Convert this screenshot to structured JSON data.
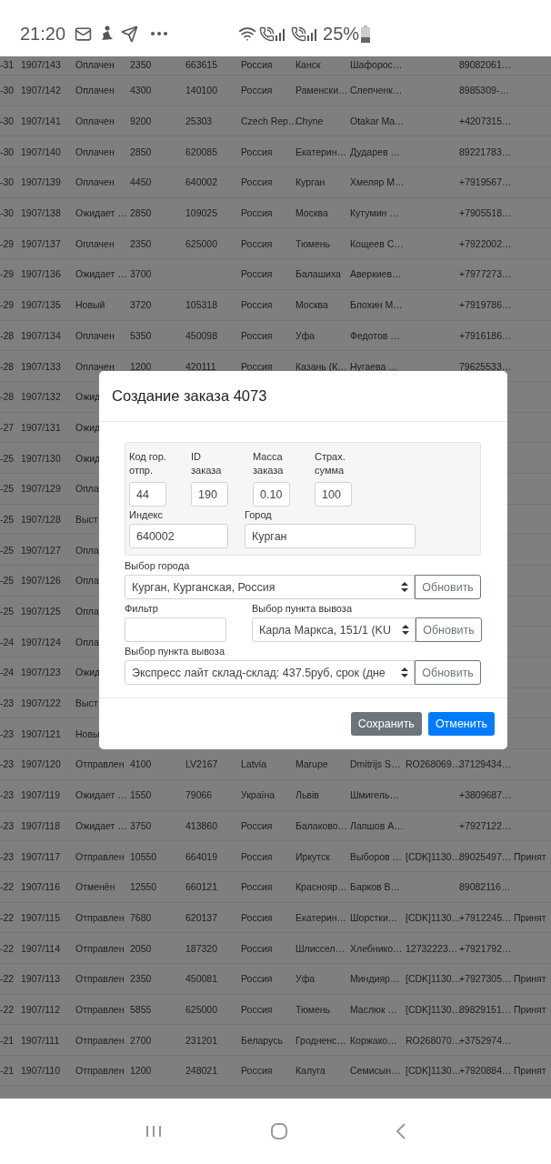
{
  "status_bar": {
    "time": "21:20",
    "battery": "25%"
  },
  "table": {
    "rows": [
      {
        "date": "-31",
        "id": "1907/143",
        "status": "Оплачен",
        "sum": "2350",
        "index": "663615",
        "country": "Россия",
        "city": "Канск",
        "name": "Шафорос…",
        "phone": "89082061…"
      },
      {
        "date": "-30",
        "id": "1907/142",
        "status": "Оплачен",
        "sum": "4300",
        "index": "140100",
        "country": "Россия",
        "city": "Раменски…",
        "name": "Слепченк…",
        "phone": "8985309-…"
      },
      {
        "date": "-30",
        "id": "1907/141",
        "status": "Оплачен",
        "sum": "9200",
        "index": "25303",
        "country": "Czech Rep…",
        "city": "Chyne",
        "name": "Otakar Ma…",
        "phone": "+4207315…"
      },
      {
        "date": "-30",
        "id": "1907/140",
        "status": "Оплачен",
        "sum": "2850",
        "index": "620085",
        "country": "Россия",
        "city": "Екатерин…",
        "name": "Дударев …",
        "phone": "89221783…"
      },
      {
        "date": "-30",
        "id": "1907/139",
        "status": "Оплачен",
        "sum": "4450",
        "index": "640002",
        "country": "Россия",
        "city": "Курган",
        "name": "Хмеляр М…",
        "phone": "+7919567…"
      },
      {
        "date": "-30",
        "id": "1907/138",
        "status": "Ожидает …",
        "sum": "2850",
        "index": "109025",
        "country": "Россия",
        "city": "Москва",
        "name": "Кутумин …",
        "phone": "+7905518…"
      },
      {
        "date": "-29",
        "id": "1907/137",
        "status": "Оплачен",
        "sum": "2350",
        "index": "625000",
        "country": "Россия",
        "city": "Тюмень",
        "name": "Кощеев С…",
        "phone": "+7922002…"
      },
      {
        "date": "-29",
        "id": "1907/136",
        "status": "Ожидает …",
        "sum": "3700",
        "country": "Россия",
        "city": "Балашиха",
        "name": "Аверкиев…",
        "phone": "+7977273…"
      },
      {
        "date": "-29",
        "id": "1907/135",
        "status": "Новый",
        "sum": "3720",
        "index": "105318",
        "country": "Россия",
        "city": "Москва",
        "name": "Блохин М…",
        "phone": "+7919786…"
      },
      {
        "date": "-28",
        "id": "1907/134",
        "status": "Оплачен",
        "sum": "5350",
        "index": "450098",
        "country": "Россия",
        "city": "Уфа",
        "name": "Федотов …",
        "phone": "+7916186…"
      },
      {
        "date": "-28",
        "id": "1907/133",
        "status": "Оплачен",
        "sum": "1200",
        "index": "420111",
        "country": "Россия",
        "city": "Казань (К…",
        "name": "Нугаева …",
        "phone": "79625533…"
      },
      {
        "date": "-28",
        "id": "1907/132",
        "status": "Ожид"
      },
      {
        "date": "-27",
        "id": "1907/131",
        "status": "Ожид"
      },
      {
        "date": "-25",
        "id": "1907/130",
        "status": "Ожид"
      },
      {
        "date": "-25",
        "id": "1907/129",
        "status": "Опла"
      },
      {
        "date": "-25",
        "id": "1907/128",
        "status": "Выст"
      },
      {
        "date": "-25",
        "id": "1907/127",
        "status": "Опла"
      },
      {
        "date": "-25",
        "id": "1907/126",
        "status": "Опла"
      },
      {
        "date": "-25",
        "id": "1907/125",
        "status": "Опла"
      },
      {
        "date": "-24",
        "id": "1907/124",
        "status": "Опла"
      },
      {
        "date": "-24",
        "id": "1907/123",
        "status": "Ожид"
      },
      {
        "date": "-23",
        "id": "1907/122",
        "status": "Выст"
      },
      {
        "date": "-23",
        "id": "1907/121",
        "status": "Новы"
      },
      {
        "date": "-23",
        "id": "1907/120",
        "status": "Отправлен",
        "sum": "4100",
        "index": "LV2167",
        "country": "Latvia",
        "city": "Marupe",
        "name": "Dmitrijs S…",
        "track": "RO268069…",
        "phone": "37129434…"
      },
      {
        "date": "-23",
        "id": "1907/119",
        "status": "Ожидает …",
        "sum": "1550",
        "index": "79066",
        "country": "Україна",
        "city": "Львів",
        "name": "Шмигель…",
        "phone": "+3809687…"
      },
      {
        "date": "-23",
        "id": "1907/118",
        "status": "Ожидает …",
        "sum": "3750",
        "index": "413860",
        "country": "Россия",
        "city": "Балаково…",
        "name": "Лапшов А…",
        "phone": "+7927122…"
      },
      {
        "date": "-23",
        "id": "1907/117",
        "status": "Отправлен",
        "sum": "10550",
        "index": "664019",
        "country": "Россия",
        "city": "Иркутск",
        "name": "Выборов …",
        "track": "[CDK]1130…",
        "phone": "89025497…",
        "comment": "Принят"
      },
      {
        "date": "-22",
        "id": "1907/116",
        "status": "Отменён",
        "sum": "12550",
        "index": "660121",
        "country": "Россия",
        "city": "Краснояр…",
        "name": "Барков В…",
        "phone": "89082116…"
      },
      {
        "date": "-22",
        "id": "1907/115",
        "status": "Отправлен",
        "sum": "7680",
        "index": "620137",
        "country": "Россия",
        "city": "Екатерин…",
        "name": "Шорстки…",
        "track": "[CDK]1130…",
        "phone": "+7912245…",
        "comment": "Принят"
      },
      {
        "date": "-22",
        "id": "1907/114",
        "status": "Отправлен",
        "sum": "2050",
        "index": "187320",
        "country": "Россия",
        "city": "Шлиссел…",
        "name": "Хлебнико…",
        "track": "12732223…",
        "phone": "+7921792…"
      },
      {
        "date": "-22",
        "id": "1907/113",
        "status": "Отправлен",
        "sum": "2350",
        "index": "450081",
        "country": "Россия",
        "city": "Уфа",
        "name": "Миндияр…",
        "track": "[CDK]1130…",
        "phone": "+7927305…",
        "comment": "Принят"
      },
      {
        "date": "-22",
        "id": "1907/112",
        "status": "Отправлен",
        "sum": "5855",
        "index": "625000",
        "country": "Россия",
        "city": "Тюмень",
        "name": "Маслюк …",
        "track": "[CDK]1130…",
        "phone": "89829151…",
        "comment": "Принят"
      },
      {
        "date": "-21",
        "id": "1907/111",
        "status": "Отправлен",
        "sum": "2700",
        "index": "231201",
        "country": "Беларусь",
        "city": "Гродненс…",
        "name": "Коржако…",
        "track": "RO268070…",
        "phone": "+3752974…"
      },
      {
        "date": "-21",
        "id": "1907/110",
        "status": "Отправлен",
        "sum": "1200",
        "index": "248021",
        "country": "Россия",
        "city": "Калуга",
        "name": "Семисын…",
        "track": "[CDK]1130…",
        "phone": "+7920884…",
        "comment": "Принят"
      }
    ]
  },
  "modal": {
    "title": "Создание заказа 4073",
    "small_fields": [
      {
        "label": "Код гор. отпр.",
        "value": "44"
      },
      {
        "label": "ID заказа",
        "value": "190"
      },
      {
        "label": "Масса заказа",
        "value": "0.10"
      },
      {
        "label": "Страх. сумма",
        "value": "100"
      }
    ],
    "index": {
      "label": "Индекс",
      "value": "640002"
    },
    "city": {
      "label": "Город",
      "value": "Курган"
    },
    "city_select": {
      "label": "Выбор города",
      "value": "Курган, Курганская, Россия",
      "button": "Обновить"
    },
    "filter": {
      "label": "Фильтр"
    },
    "pickup_select": {
      "label": "Выбор пункта вывоза",
      "value": "Карла Маркса, 151/1 (KU",
      "button": "Обновить"
    },
    "tariff_select": {
      "label": "Выбор пункта вывоза",
      "value": "Экспресс лайт склад-склад: 437.5руб, срок (дне",
      "button": "Обновить"
    },
    "buttons": [
      {
        "label": "Сохранить",
        "kind": "secondary"
      },
      {
        "label": "Отменить",
        "kind": "primary"
      }
    ]
  }
}
